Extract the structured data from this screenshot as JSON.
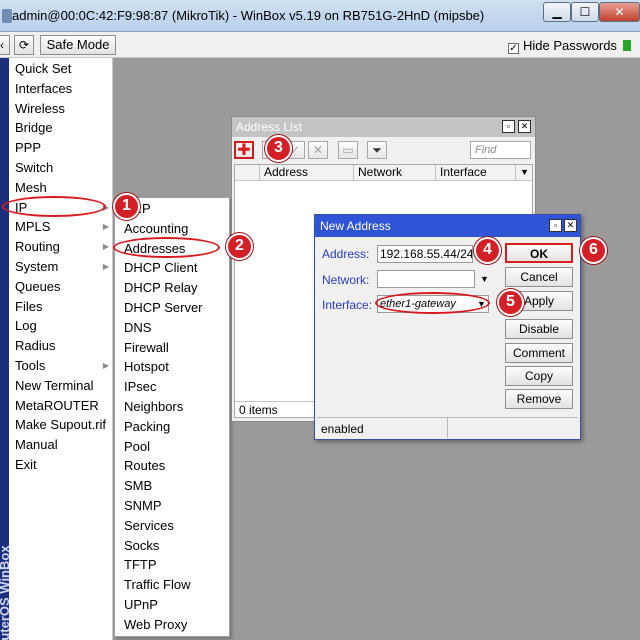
{
  "window": {
    "title": "admin@00:0C:42:F9:98:87 (MikroTik) - WinBox v5.19 on RB751G-2HnD (mipsbe)",
    "minimize": "▁",
    "maximize": "☐",
    "close": "✕"
  },
  "toolbar": {
    "back": "‹",
    "redo": "⟳",
    "safe_mode": "Safe Mode",
    "hide_passwords": "Hide Passwords",
    "hide_passwords_checked": true
  },
  "sidebar_brand": "RouterOS WinBox",
  "main_menu": [
    {
      "label": "Quick Set",
      "has_submenu": false
    },
    {
      "label": "Interfaces",
      "has_submenu": false
    },
    {
      "label": "Wireless",
      "has_submenu": false
    },
    {
      "label": "Bridge",
      "has_submenu": false
    },
    {
      "label": "PPP",
      "has_submenu": false
    },
    {
      "label": "Switch",
      "has_submenu": false
    },
    {
      "label": "Mesh",
      "has_submenu": false
    },
    {
      "label": "IP",
      "has_submenu": true
    },
    {
      "label": "MPLS",
      "has_submenu": true
    },
    {
      "label": "Routing",
      "has_submenu": true
    },
    {
      "label": "System",
      "has_submenu": true
    },
    {
      "label": "Queues",
      "has_submenu": false
    },
    {
      "label": "Files",
      "has_submenu": false
    },
    {
      "label": "Log",
      "has_submenu": false
    },
    {
      "label": "Radius",
      "has_submenu": false
    },
    {
      "label": "Tools",
      "has_submenu": true
    },
    {
      "label": "New Terminal",
      "has_submenu": false
    },
    {
      "label": "MetaROUTER",
      "has_submenu": false
    },
    {
      "label": "Make Supout.rif",
      "has_submenu": false
    },
    {
      "label": "Manual",
      "has_submenu": false
    },
    {
      "label": "Exit",
      "has_submenu": false
    }
  ],
  "submenu_arrow": "▶",
  "ip_submenu": [
    "ARP",
    "Accounting",
    "Addresses",
    "DHCP Client",
    "DHCP Relay",
    "DHCP Server",
    "DNS",
    "Firewall",
    "Hotspot",
    "IPsec",
    "Neighbors",
    "Packing",
    "Pool",
    "Routes",
    "SMB",
    "SNMP",
    "Services",
    "Socks",
    "TFTP",
    "Traffic Flow",
    "UPnP",
    "Web Proxy"
  ],
  "address_list": {
    "title": "Address List",
    "restore": "▫",
    "close": "✕",
    "buttons": {
      "add": "✚",
      "remove": "−",
      "enable": "✓",
      "disable": "✕",
      "comment": "▭",
      "filter": "⏷"
    },
    "find_placeholder": "Find",
    "columns": [
      "Address",
      "Network",
      "Interface"
    ],
    "column_dropdown": "▼",
    "count": "0 items"
  },
  "new_address": {
    "title": "New Address",
    "restore": "▫",
    "close": "✕",
    "address_label": "Address:",
    "address_value": "192.168.55.44/24",
    "network_label": "Network:",
    "network_value": "",
    "interface_label": "Interface:",
    "interface_value": "ether1-gateway",
    "dropdown": "▼",
    "buttons": [
      "OK",
      "Cancel",
      "Apply",
      "Disable",
      "Comment",
      "Copy",
      "Remove"
    ],
    "status": "enabled"
  },
  "step_markers": [
    "1",
    "2",
    "3",
    "4",
    "5",
    "6"
  ],
  "colors": {
    "accent_red": "#d31f26",
    "dialog_title_blue": "#2f54d6",
    "brand_strip": "#1c2f7d"
  }
}
